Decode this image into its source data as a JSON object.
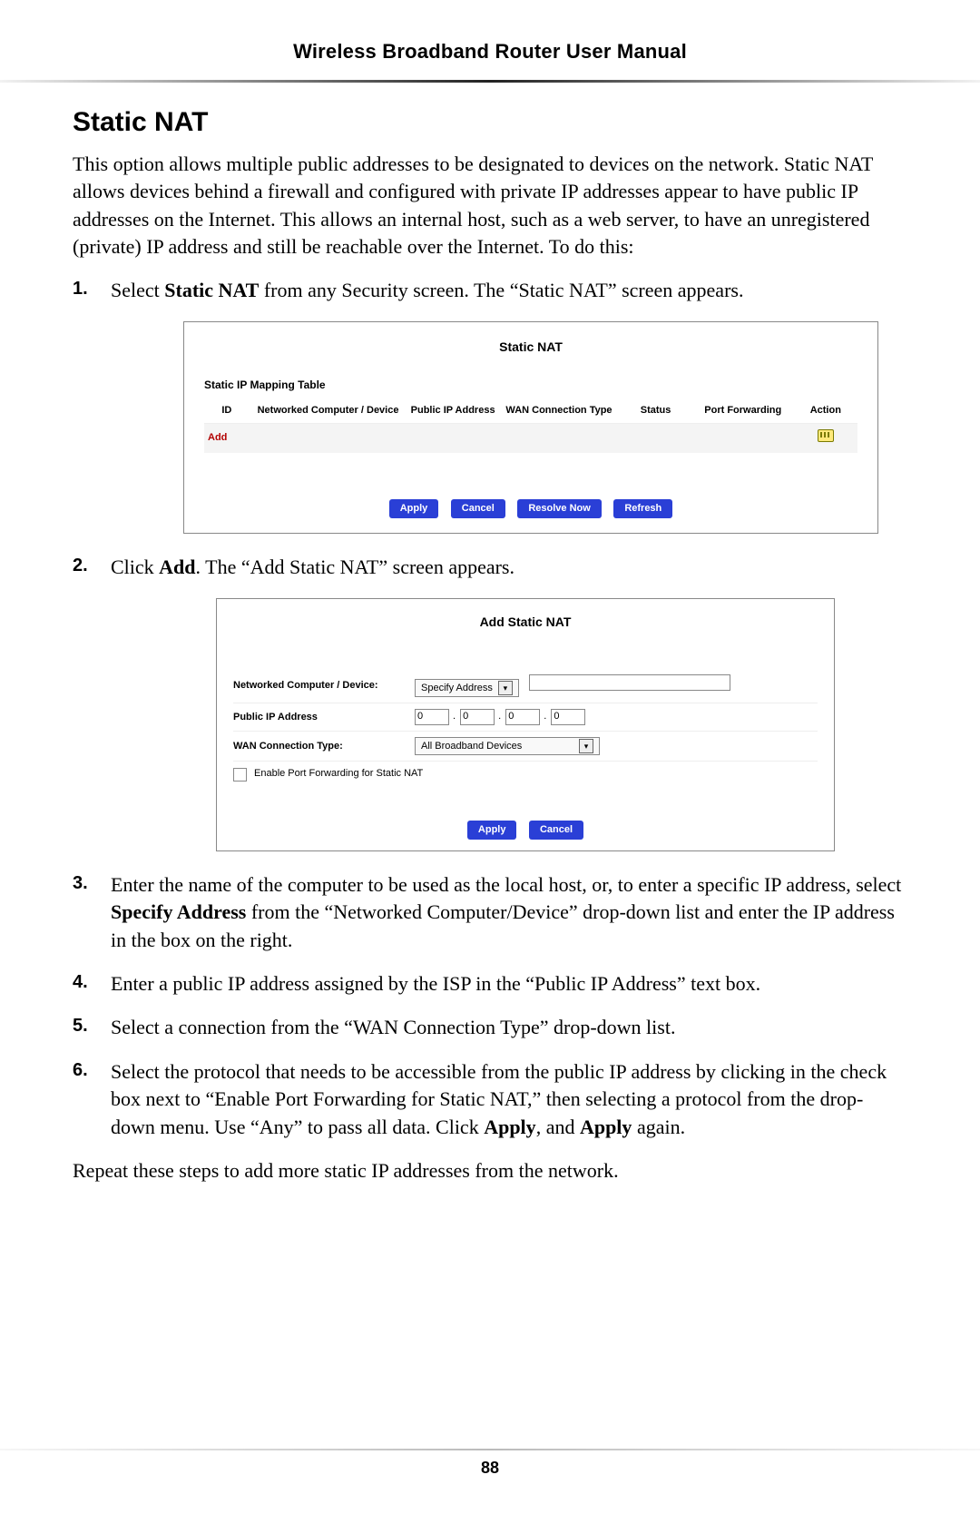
{
  "header": {
    "title": "Wireless Broadband Router User Manual"
  },
  "section_title": "Static NAT",
  "intro": "This option allows multiple public addresses to be designated to devices on the network. Static NAT allows devices behind a firewall and configured with private IP addresses appear to have public IP addresses on the Internet. This allows an internal host, such as a web server, to have an unregistered (private) IP address and still be reachable over the Internet. To do this:",
  "steps": {
    "s1_a": "Select ",
    "s1_b": "Static NAT",
    "s1_c": " from any Security screen. The “Static NAT” screen appears.",
    "s2_a": "Click ",
    "s2_b": "Add",
    "s2_c": ". The “Add Static NAT” screen appears.",
    "s3_a": "Enter the name of the computer to be used as the local host, or, to enter a specific IP address, select ",
    "s3_b": "Specify Address",
    "s3_c": " from the “Networked Computer/Device” drop-down list and enter the IP address in the box on the right.",
    "s4": "Enter a public IP address assigned by the ISP in the “Public IP Address” text box.",
    "s5": "Select a connection from the “WAN Connection Type” drop-down list.",
    "s6_a": "Select the protocol that needs to be accessible from the public IP address by clicking in the check box next to “Enable Port Forwarding for Static NAT,” then selecting a protocol from the drop-down menu. Use “Any” to pass all data. Click ",
    "s6_b": "Apply",
    "s6_c": ", and ",
    "s6_d": "Apply",
    "s6_e": " again."
  },
  "closing": "Repeat these steps to add more static IP addresses from the network.",
  "fig1": {
    "title": "Static NAT",
    "subtitle": "Static IP Mapping Table",
    "cols": [
      "ID",
      "Networked Computer / Device",
      "Public IP Address",
      "WAN Connection Type",
      "Status",
      "Port Forwarding",
      "Action"
    ],
    "add": "Add",
    "buttons": [
      "Apply",
      "Cancel",
      "Resolve Now",
      "Refresh"
    ]
  },
  "fig2": {
    "title": "Add Static NAT",
    "row1_label": "Networked Computer / Device:",
    "row1_select": "Specify Address",
    "row2_label": "Public IP Address",
    "ip": [
      "0",
      "0",
      "0",
      "0"
    ],
    "row3_label": "WAN Connection Type:",
    "row3_select": "All Broadband Devices",
    "enable_pf": "Enable Port Forwarding for Static NAT",
    "buttons": [
      "Apply",
      "Cancel"
    ]
  },
  "page_number": "88",
  "nums": {
    "n1": "1.",
    "n2": "2.",
    "n3": "3.",
    "n4": "4.",
    "n5": "5.",
    "n6": "6."
  },
  "glyphs": {
    "chev": "▾"
  }
}
